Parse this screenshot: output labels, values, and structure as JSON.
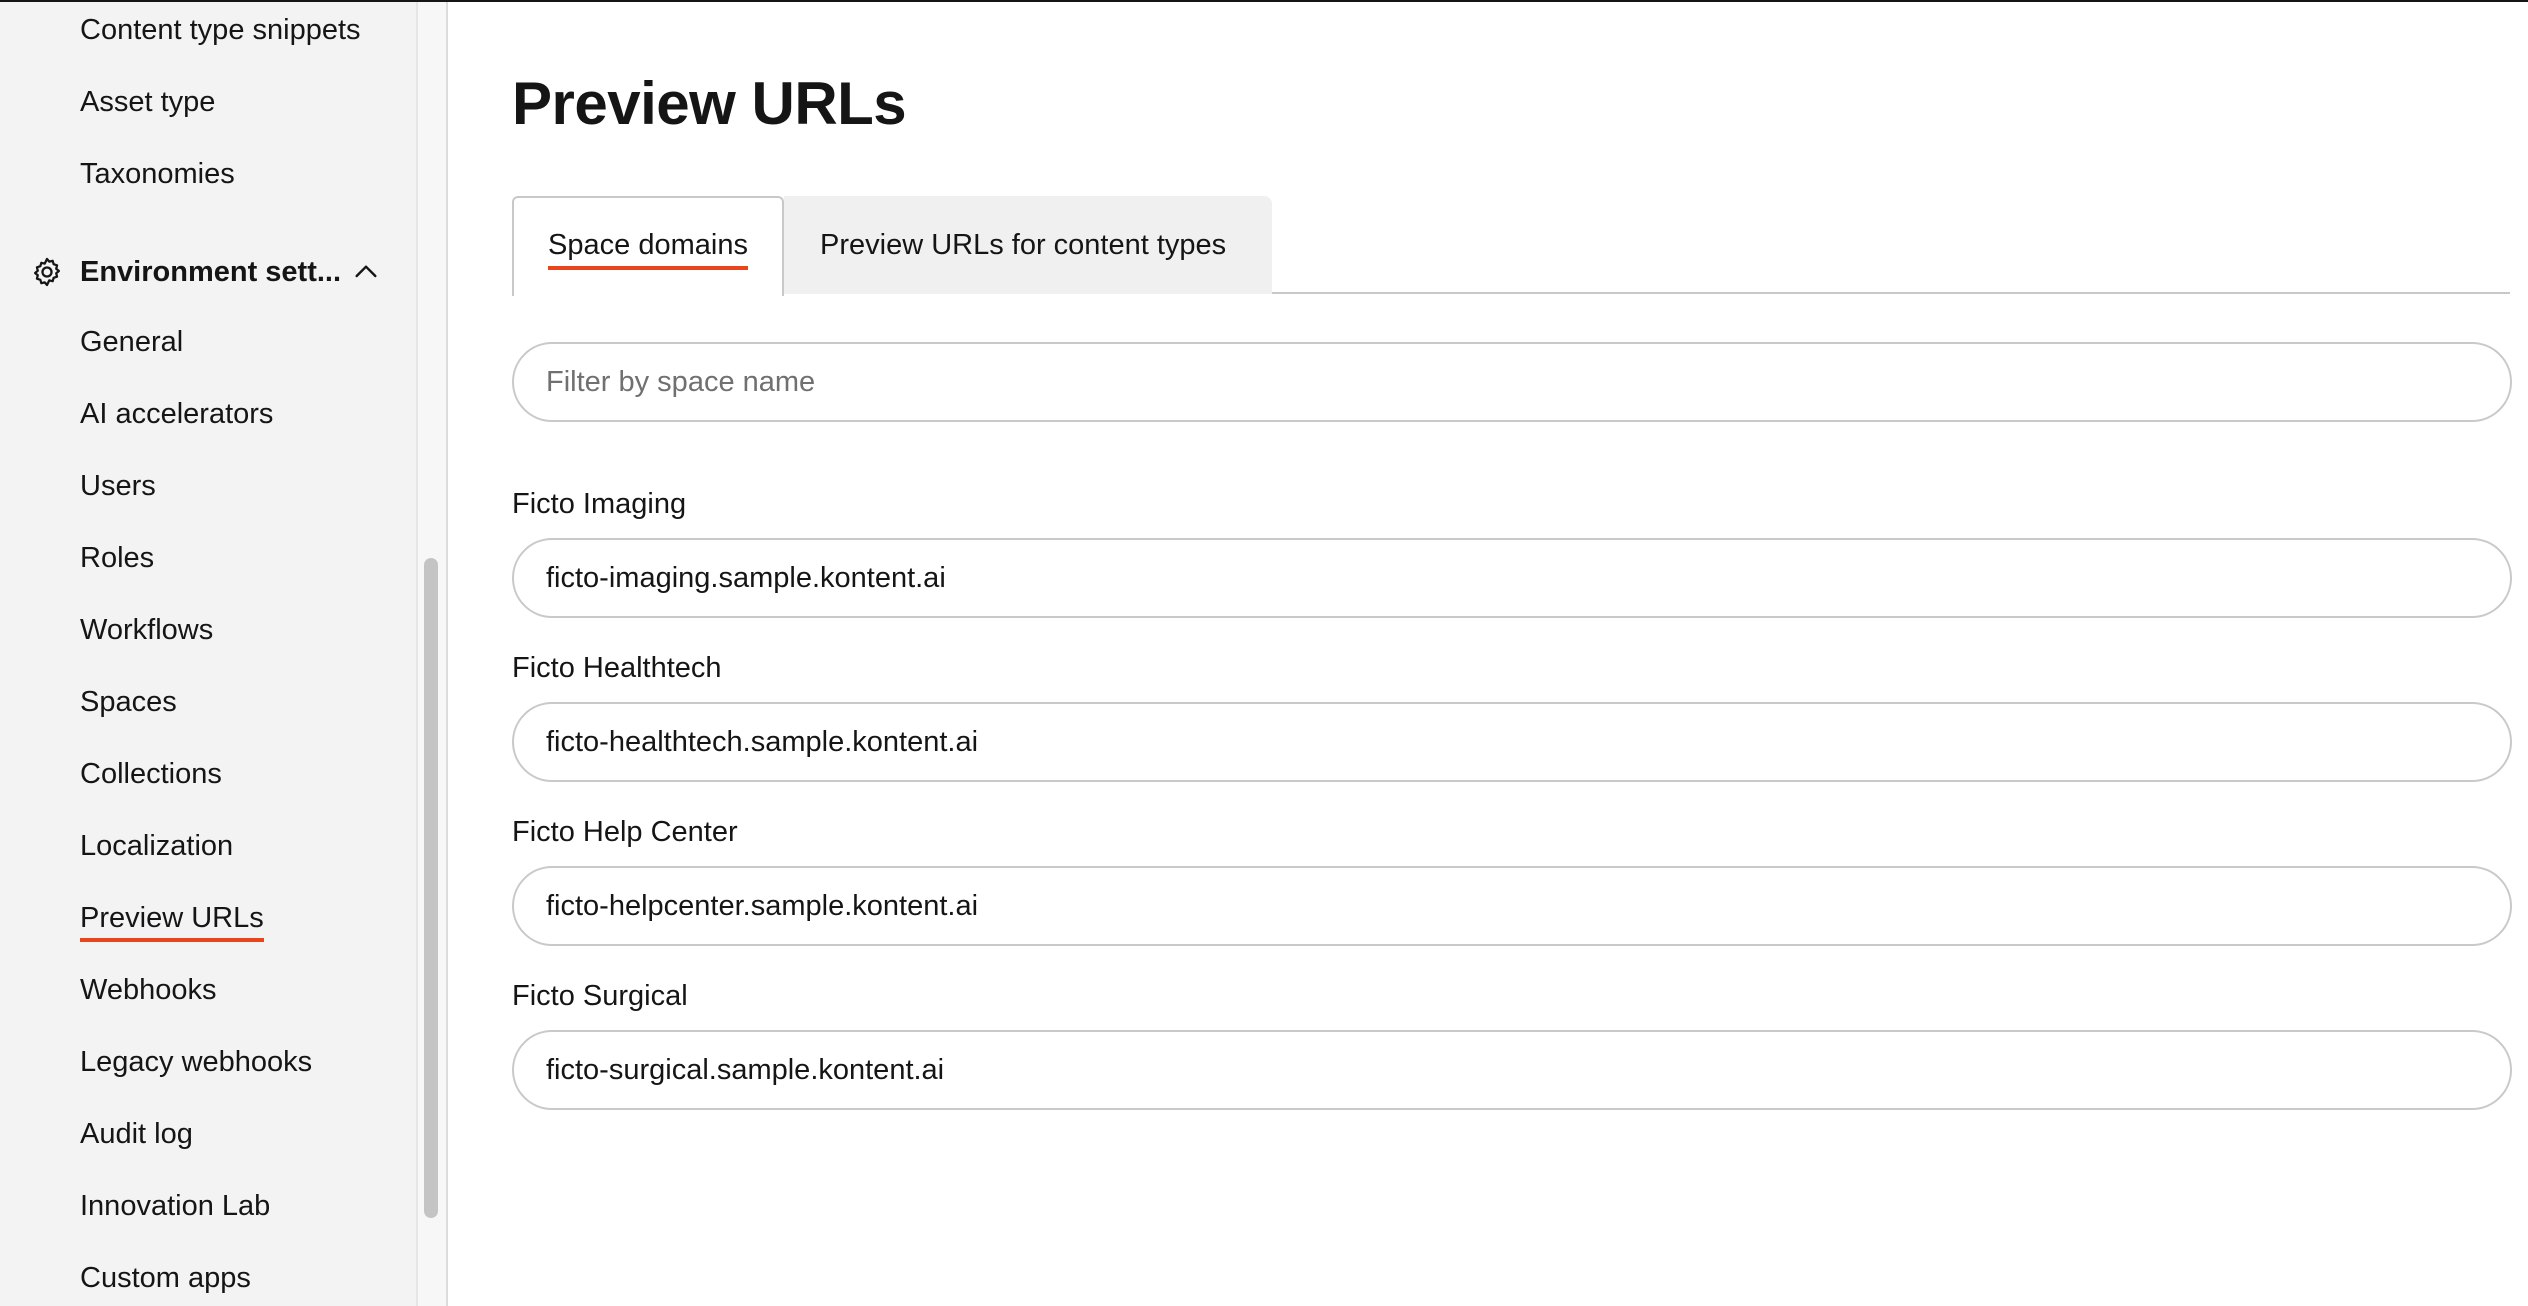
{
  "sidebar": {
    "items_top": [
      {
        "label": "Content type snippets"
      },
      {
        "label": "Asset type"
      },
      {
        "label": "Taxonomies"
      }
    ],
    "group": {
      "label": "Environment sett...",
      "icon": "gear-icon",
      "expanded": true
    },
    "items": [
      {
        "label": "General"
      },
      {
        "label": "AI accelerators"
      },
      {
        "label": "Users"
      },
      {
        "label": "Roles"
      },
      {
        "label": "Workflows"
      },
      {
        "label": "Spaces"
      },
      {
        "label": "Collections"
      },
      {
        "label": "Localization"
      },
      {
        "label": "Preview URLs",
        "active": true
      },
      {
        "label": "Webhooks"
      },
      {
        "label": "Legacy webhooks"
      },
      {
        "label": "Audit log"
      },
      {
        "label": "Innovation Lab"
      },
      {
        "label": "Custom apps"
      }
    ]
  },
  "main": {
    "title": "Preview URLs",
    "tabs": [
      {
        "label": "Space domains",
        "active": true
      },
      {
        "label": "Preview URLs for content types",
        "active": false
      }
    ],
    "filter": {
      "placeholder": "Filter by space name",
      "value": ""
    },
    "spaces": [
      {
        "name": "Ficto Imaging",
        "domain": "ficto-imaging.sample.kontent.ai"
      },
      {
        "name": "Ficto Healthtech",
        "domain": "ficto-healthtech.sample.kontent.ai"
      },
      {
        "name": "Ficto Help Center",
        "domain": "ficto-helpcenter.sample.kontent.ai"
      },
      {
        "name": "Ficto Surgical",
        "domain": "ficto-surgical.sample.kontent.ai"
      }
    ]
  },
  "colors": {
    "accent": "#e8451d",
    "sidebar_bg": "#f3f3f3",
    "text": "#151515"
  }
}
